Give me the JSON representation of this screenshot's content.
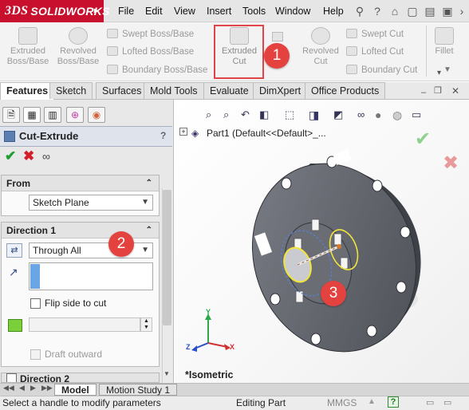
{
  "app": {
    "brand_prefix": "3DS",
    "brand_name": "SOLIDWORKS"
  },
  "menu": [
    "File",
    "Edit",
    "View",
    "Insert",
    "Tools",
    "Window",
    "Help"
  ],
  "toolbar": {
    "extruded_boss": "Extruded\nBoss/Base",
    "revolved_boss": "Revolved\nBoss/Base",
    "swept_boss": "Swept Boss/Base",
    "lofted_boss": "Lofted Boss/Base",
    "boundary_boss": "Boundary Boss/Base",
    "extruded_cut": "Extruded\nCut",
    "revolved_cut": "Revolved\nCut",
    "swept_cut": "Swept Cut",
    "lofted_cut": "Lofted Cut",
    "boundary_cut": "Boundary Cut",
    "fillet": "Fillet"
  },
  "tabs": [
    "Features",
    "Sketch",
    "Surfaces",
    "Mold Tools",
    "Evaluate",
    "DimXpert",
    "Office Products"
  ],
  "property_manager": {
    "title": "Cut-Extrude",
    "help": "?",
    "from": {
      "label": "From",
      "value": "Sketch Plane"
    },
    "direction1": {
      "label": "Direction 1",
      "end_condition": "Through All",
      "flip_label": "Flip side to cut",
      "draft_label": "Draft outward"
    },
    "direction2": {
      "label": "Direction 2"
    }
  },
  "tree": {
    "root": "Part1  (Default<<Default>_..."
  },
  "view": {
    "orientation": "*Isometric"
  },
  "axes": {
    "x": "X",
    "y": "Y",
    "z": "Z"
  },
  "callouts": {
    "one": "1",
    "two": "2",
    "three": "3"
  },
  "bottom_tabs": [
    "Model",
    "Motion Study 1"
  ],
  "status": {
    "message": "Select a handle to modify parameters",
    "mode": "Editing Part",
    "units": "MMGS",
    "help": "?"
  },
  "colors": {
    "brand": "#c8102e",
    "callout": "#e4423e",
    "part": "#5f6168",
    "part_dark": "#464950",
    "sketch": "#f2e53a"
  }
}
